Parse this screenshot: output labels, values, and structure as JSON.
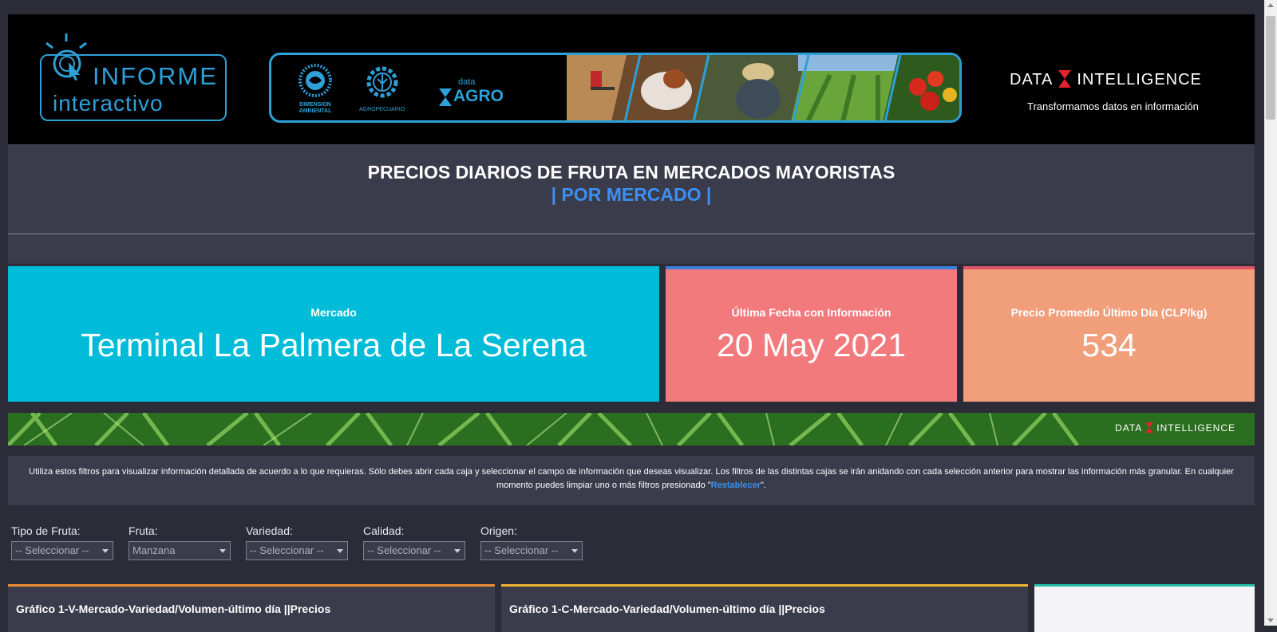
{
  "banner": {
    "logo": {
      "title": "INFORME",
      "subtitle": "interactivo"
    },
    "partners": [
      {
        "name": "DIMENSION AMBIENTAL",
        "icon": "sun-seal-icon"
      },
      {
        "name": "AGROPECUARIO",
        "icon": "gear-wheat-icon"
      }
    ],
    "data_agro": {
      "small": "data",
      "big": "AGRO"
    },
    "brand": {
      "left": "DATA",
      "right": "INTELLIGENCE",
      "tagline": "Transformamos datos en información"
    }
  },
  "header": {
    "title": "PRECIOS DIARIOS DE FRUTA EN MERCADOS MAYORISTAS",
    "subtitle": "| POR MERCADO |"
  },
  "kpis": [
    {
      "label": "Mercado",
      "value": "Terminal La Palmera de La Serena",
      "color": "#00bcd9"
    },
    {
      "label": "Última Fecha con Información",
      "value": "20 May 2021",
      "color": "#f27a7d"
    },
    {
      "label": "Precio Promedio Último Día (CLP/kg)",
      "value": "534",
      "color": "#f19e7b"
    }
  ],
  "strip": {
    "brand_left": "DATA",
    "brand_right": "INTELLIGENCE"
  },
  "info": {
    "text_before": "Utiliza estos filtros para visualizar información detallada de acuerdo a lo que requieras. Sólo debes abrir cada caja y seleccionar el campo de información que deseas visualizar. Los filtros de las distintas cajas se irán anidando con cada selección anterior para mostrar las información más granular. En cualquier momento puedes limpiar uno o más filtros presionado \"",
    "link": "Restablecer",
    "text_after": "\"."
  },
  "filters": [
    {
      "label": "Tipo de Fruta:",
      "value": "-- Seleccionar --"
    },
    {
      "label": "Fruta:",
      "value": "Manzana"
    },
    {
      "label": "Variedad:",
      "value": "-- Seleccionar --"
    },
    {
      "label": "Calidad:",
      "value": "-- Seleccionar --"
    },
    {
      "label": "Origen:",
      "value": "-- Seleccionar --"
    }
  ],
  "panels": [
    {
      "title": "Gráfico 1-V-Mercado-Variedad/Volumen-último día ||Precios"
    },
    {
      "title": "Gráfico 1-C-Mercado-Variedad/Volumen-último día ||Precios"
    },
    {
      "title": ""
    }
  ],
  "colors": {
    "background": "#2b2c38",
    "panel": "#3a3b4b",
    "accent_blue": "#3d8ff2",
    "logo_blue": "#2ea0d8"
  }
}
